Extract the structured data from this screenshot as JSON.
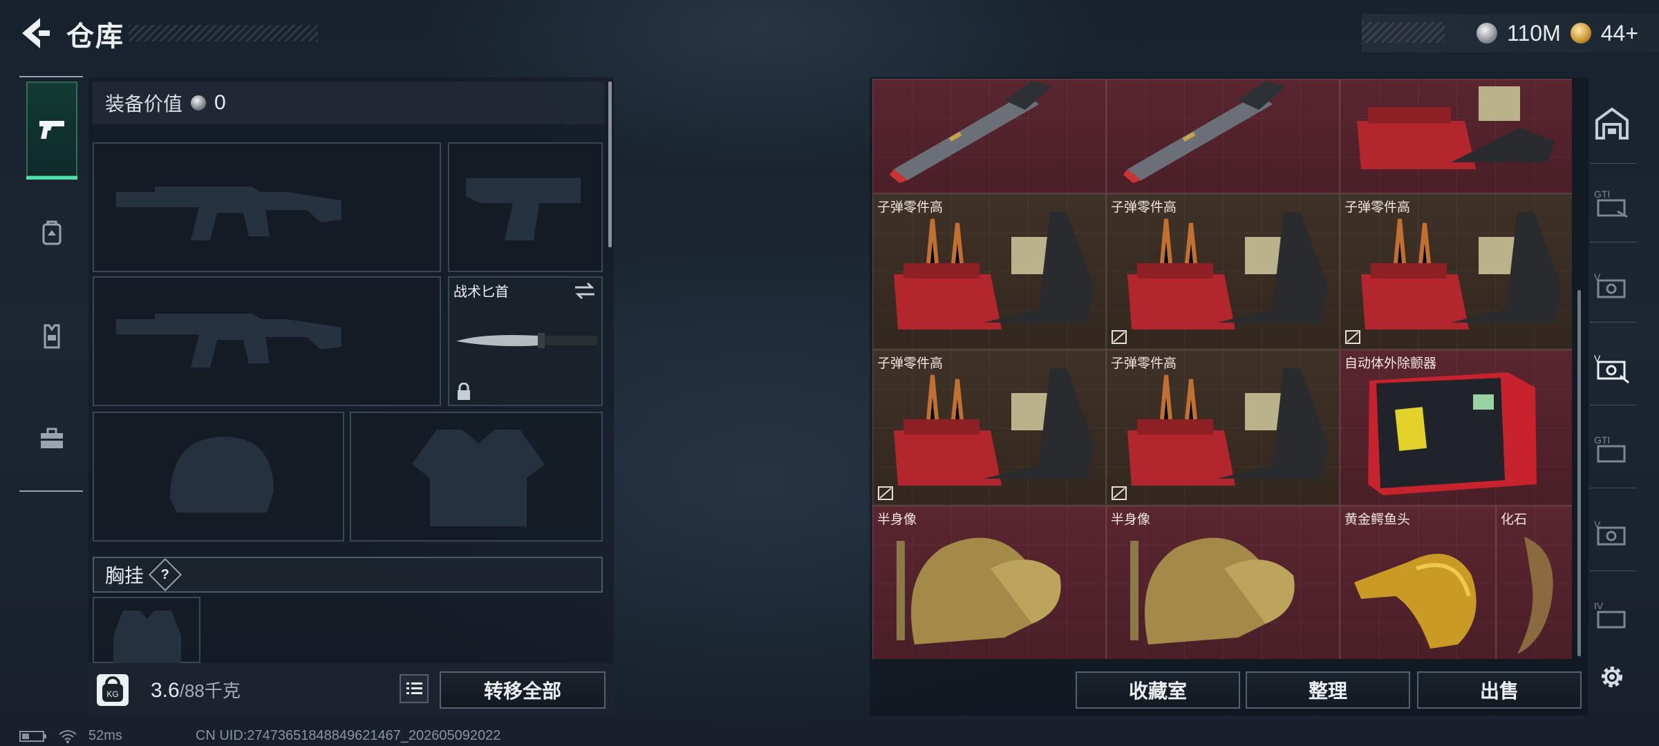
{
  "header": {
    "title": "仓库"
  },
  "currency": [
    {
      "name": "silver",
      "value": "110M"
    },
    {
      "name": "gold",
      "value": "44+"
    }
  ],
  "loadout": {
    "equipment_value_label": "装备价值",
    "equipment_value": "0",
    "knife_label": "战术匕首",
    "chest_rig_label": "胸挂",
    "chest_help": "?"
  },
  "weight": {
    "current": "3.6",
    "capacity": "/88千克",
    "icon_text": "KG"
  },
  "left_actions": {
    "transfer_all": "转移全部"
  },
  "storage_actions": {
    "collection": "收藏室",
    "sort": "整理",
    "sell": "出售"
  },
  "storage_items": [
    {
      "label": "",
      "type": "missile"
    },
    {
      "label": "",
      "type": "missile"
    },
    {
      "label": "",
      "type": "ammo-parts"
    },
    {
      "label": "子弹零件高",
      "type": "ammo-parts"
    },
    {
      "label": "子弹零件高",
      "type": "ammo-parts"
    },
    {
      "label": "子弹零件高",
      "type": "ammo-parts"
    },
    {
      "label": "子弹零件高",
      "type": "ammo-parts"
    },
    {
      "label": "子弹零件高",
      "type": "ammo-parts"
    },
    {
      "label": "自动体外除颤器",
      "type": "aed"
    },
    {
      "label": "半身像",
      "type": "bust"
    },
    {
      "label": "半身像",
      "type": "bust"
    },
    {
      "label": "黄金鳄鱼头",
      "type": "gold-croc"
    },
    {
      "label": "化石",
      "type": "fossil"
    }
  ],
  "footer": {
    "latency": "52ms",
    "uid": "CN UID:2747365184884962146​7_202605092022"
  },
  "colors": {
    "accent": "#4fe0a8",
    "cell_red": "#5a2630",
    "cell_brown": "#3e3128"
  },
  "icons": [
    "back-arrow-icon",
    "silver-coin-icon",
    "gold-coin-icon",
    "pistol-icon",
    "backpack-icon",
    "vest-icon",
    "toolbox-icon",
    "swap-icon",
    "lock-icon",
    "list-icon",
    "gear-icon",
    "battery-icon",
    "wifi-icon"
  ]
}
